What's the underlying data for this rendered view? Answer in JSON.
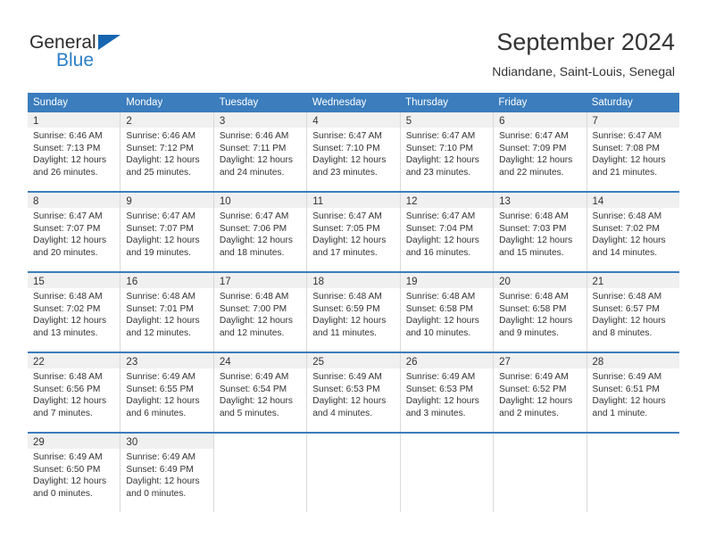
{
  "brand": {
    "name_part1": "General",
    "name_part2": "Blue",
    "triangle_color": "#1565b0",
    "blue_color": "#2a7fc9"
  },
  "header": {
    "title": "September 2024",
    "subtitle": "Ndiandane, Saint-Louis, Senegal"
  },
  "theme": {
    "header_bg": "#3b7dbd",
    "daynum_bg": "#f0f0f0",
    "grid_line": "#d9d9d9",
    "text": "#333333"
  },
  "weekdays": [
    "Sunday",
    "Monday",
    "Tuesday",
    "Wednesday",
    "Thursday",
    "Friday",
    "Saturday"
  ],
  "labels": {
    "sunrise": "Sunrise:",
    "sunset": "Sunset:",
    "daylight": "Daylight:"
  },
  "weeks": [
    {
      "days": [
        {
          "day": "1",
          "sunrise": "Sunrise: 6:46 AM",
          "sunset": "Sunset: 7:13 PM",
          "daylight1": "Daylight: 12 hours",
          "daylight2": "and 26 minutes."
        },
        {
          "day": "2",
          "sunrise": "Sunrise: 6:46 AM",
          "sunset": "Sunset: 7:12 PM",
          "daylight1": "Daylight: 12 hours",
          "daylight2": "and 25 minutes."
        },
        {
          "day": "3",
          "sunrise": "Sunrise: 6:46 AM",
          "sunset": "Sunset: 7:11 PM",
          "daylight1": "Daylight: 12 hours",
          "daylight2": "and 24 minutes."
        },
        {
          "day": "4",
          "sunrise": "Sunrise: 6:47 AM",
          "sunset": "Sunset: 7:10 PM",
          "daylight1": "Daylight: 12 hours",
          "daylight2": "and 23 minutes."
        },
        {
          "day": "5",
          "sunrise": "Sunrise: 6:47 AM",
          "sunset": "Sunset: 7:10 PM",
          "daylight1": "Daylight: 12 hours",
          "daylight2": "and 23 minutes."
        },
        {
          "day": "6",
          "sunrise": "Sunrise: 6:47 AM",
          "sunset": "Sunset: 7:09 PM",
          "daylight1": "Daylight: 12 hours",
          "daylight2": "and 22 minutes."
        },
        {
          "day": "7",
          "sunrise": "Sunrise: 6:47 AM",
          "sunset": "Sunset: 7:08 PM",
          "daylight1": "Daylight: 12 hours",
          "daylight2": "and 21 minutes."
        }
      ]
    },
    {
      "days": [
        {
          "day": "8",
          "sunrise": "Sunrise: 6:47 AM",
          "sunset": "Sunset: 7:07 PM",
          "daylight1": "Daylight: 12 hours",
          "daylight2": "and 20 minutes."
        },
        {
          "day": "9",
          "sunrise": "Sunrise: 6:47 AM",
          "sunset": "Sunset: 7:07 PM",
          "daylight1": "Daylight: 12 hours",
          "daylight2": "and 19 minutes."
        },
        {
          "day": "10",
          "sunrise": "Sunrise: 6:47 AM",
          "sunset": "Sunset: 7:06 PM",
          "daylight1": "Daylight: 12 hours",
          "daylight2": "and 18 minutes."
        },
        {
          "day": "11",
          "sunrise": "Sunrise: 6:47 AM",
          "sunset": "Sunset: 7:05 PM",
          "daylight1": "Daylight: 12 hours",
          "daylight2": "and 17 minutes."
        },
        {
          "day": "12",
          "sunrise": "Sunrise: 6:47 AM",
          "sunset": "Sunset: 7:04 PM",
          "daylight1": "Daylight: 12 hours",
          "daylight2": "and 16 minutes."
        },
        {
          "day": "13",
          "sunrise": "Sunrise: 6:48 AM",
          "sunset": "Sunset: 7:03 PM",
          "daylight1": "Daylight: 12 hours",
          "daylight2": "and 15 minutes."
        },
        {
          "day": "14",
          "sunrise": "Sunrise: 6:48 AM",
          "sunset": "Sunset: 7:02 PM",
          "daylight1": "Daylight: 12 hours",
          "daylight2": "and 14 minutes."
        }
      ]
    },
    {
      "days": [
        {
          "day": "15",
          "sunrise": "Sunrise: 6:48 AM",
          "sunset": "Sunset: 7:02 PM",
          "daylight1": "Daylight: 12 hours",
          "daylight2": "and 13 minutes."
        },
        {
          "day": "16",
          "sunrise": "Sunrise: 6:48 AM",
          "sunset": "Sunset: 7:01 PM",
          "daylight1": "Daylight: 12 hours",
          "daylight2": "and 12 minutes."
        },
        {
          "day": "17",
          "sunrise": "Sunrise: 6:48 AM",
          "sunset": "Sunset: 7:00 PM",
          "daylight1": "Daylight: 12 hours",
          "daylight2": "and 12 minutes."
        },
        {
          "day": "18",
          "sunrise": "Sunrise: 6:48 AM",
          "sunset": "Sunset: 6:59 PM",
          "daylight1": "Daylight: 12 hours",
          "daylight2": "and 11 minutes."
        },
        {
          "day": "19",
          "sunrise": "Sunrise: 6:48 AM",
          "sunset": "Sunset: 6:58 PM",
          "daylight1": "Daylight: 12 hours",
          "daylight2": "and 10 minutes."
        },
        {
          "day": "20",
          "sunrise": "Sunrise: 6:48 AM",
          "sunset": "Sunset: 6:58 PM",
          "daylight1": "Daylight: 12 hours",
          "daylight2": "and 9 minutes."
        },
        {
          "day": "21",
          "sunrise": "Sunrise: 6:48 AM",
          "sunset": "Sunset: 6:57 PM",
          "daylight1": "Daylight: 12 hours",
          "daylight2": "and 8 minutes."
        }
      ]
    },
    {
      "days": [
        {
          "day": "22",
          "sunrise": "Sunrise: 6:48 AM",
          "sunset": "Sunset: 6:56 PM",
          "daylight1": "Daylight: 12 hours",
          "daylight2": "and 7 minutes."
        },
        {
          "day": "23",
          "sunrise": "Sunrise: 6:49 AM",
          "sunset": "Sunset: 6:55 PM",
          "daylight1": "Daylight: 12 hours",
          "daylight2": "and 6 minutes."
        },
        {
          "day": "24",
          "sunrise": "Sunrise: 6:49 AM",
          "sunset": "Sunset: 6:54 PM",
          "daylight1": "Daylight: 12 hours",
          "daylight2": "and 5 minutes."
        },
        {
          "day": "25",
          "sunrise": "Sunrise: 6:49 AM",
          "sunset": "Sunset: 6:53 PM",
          "daylight1": "Daylight: 12 hours",
          "daylight2": "and 4 minutes."
        },
        {
          "day": "26",
          "sunrise": "Sunrise: 6:49 AM",
          "sunset": "Sunset: 6:53 PM",
          "daylight1": "Daylight: 12 hours",
          "daylight2": "and 3 minutes."
        },
        {
          "day": "27",
          "sunrise": "Sunrise: 6:49 AM",
          "sunset": "Sunset: 6:52 PM",
          "daylight1": "Daylight: 12 hours",
          "daylight2": "and 2 minutes."
        },
        {
          "day": "28",
          "sunrise": "Sunrise: 6:49 AM",
          "sunset": "Sunset: 6:51 PM",
          "daylight1": "Daylight: 12 hours",
          "daylight2": "and 1 minute."
        }
      ]
    },
    {
      "days": [
        {
          "day": "29",
          "sunrise": "Sunrise: 6:49 AM",
          "sunset": "Sunset: 6:50 PM",
          "daylight1": "Daylight: 12 hours",
          "daylight2": "and 0 minutes."
        },
        {
          "day": "30",
          "sunrise": "Sunrise: 6:49 AM",
          "sunset": "Sunset: 6:49 PM",
          "daylight1": "Daylight: 12 hours",
          "daylight2": "and 0 minutes."
        },
        {
          "day": "",
          "sunrise": "",
          "sunset": "",
          "daylight1": "",
          "daylight2": ""
        },
        {
          "day": "",
          "sunrise": "",
          "sunset": "",
          "daylight1": "",
          "daylight2": ""
        },
        {
          "day": "",
          "sunrise": "",
          "sunset": "",
          "daylight1": "",
          "daylight2": ""
        },
        {
          "day": "",
          "sunrise": "",
          "sunset": "",
          "daylight1": "",
          "daylight2": ""
        },
        {
          "day": "",
          "sunrise": "",
          "sunset": "",
          "daylight1": "",
          "daylight2": ""
        }
      ]
    }
  ]
}
